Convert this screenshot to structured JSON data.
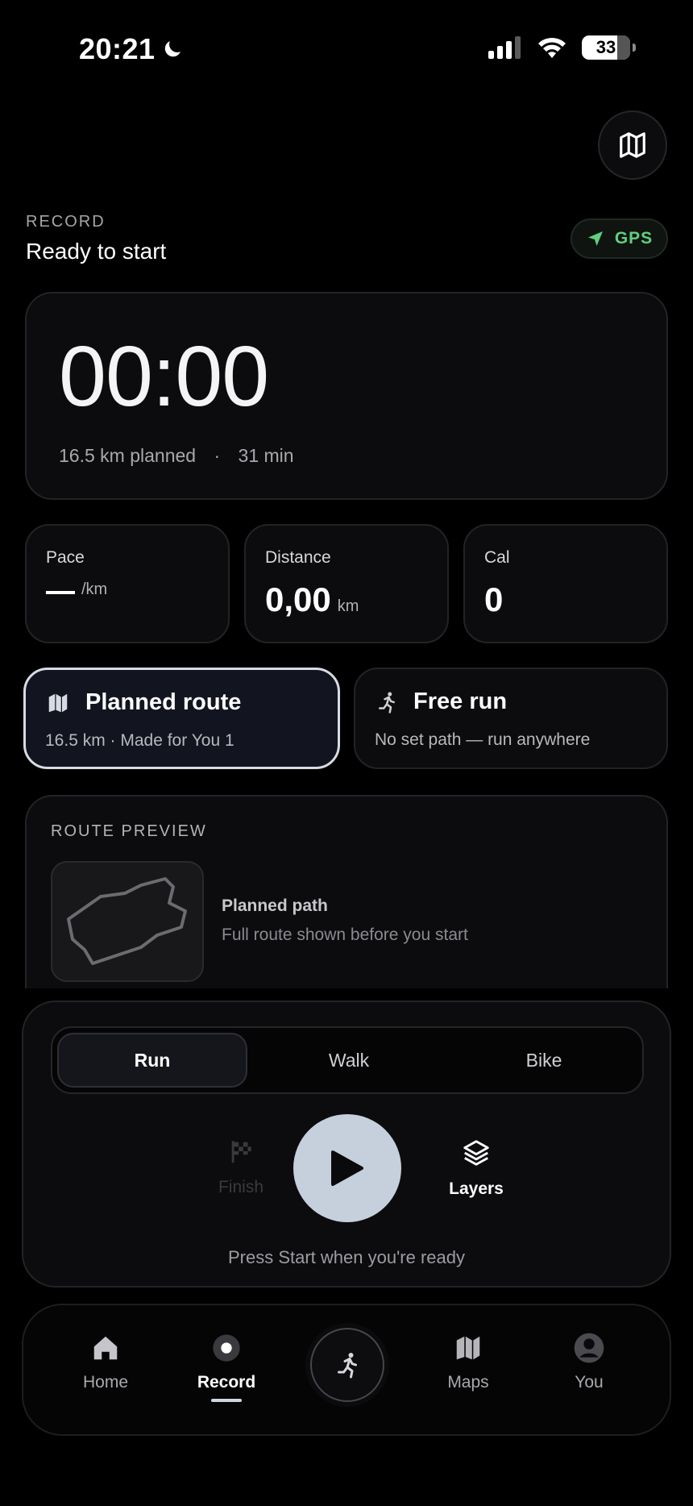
{
  "status_bar": {
    "time": "20:21",
    "battery": "33"
  },
  "header": {
    "section_label": "RECORD",
    "status": "Ready to start",
    "gps_label": "GPS"
  },
  "timer": {
    "value": "00:00",
    "planned_distance": "16.5 km planned",
    "separator": "·",
    "planned_time": "31 min"
  },
  "stats": [
    {
      "label": "Pace",
      "value": "",
      "unit": "/km"
    },
    {
      "label": "Distance",
      "value": "0,00",
      "unit": "km"
    },
    {
      "label": "Cal",
      "value": "0",
      "unit": ""
    }
  ],
  "route_options": [
    {
      "title": "Planned route",
      "subtitle": "16.5 km · Made for You 1",
      "icon": "map-icon",
      "selected": true
    },
    {
      "title": "Free run",
      "subtitle": "No set path — run anywhere",
      "icon": "runner-icon",
      "selected": false
    }
  ],
  "route_preview": {
    "label": "ROUTE PREVIEW",
    "title": "Planned path",
    "subtitle": "Full route shown before you start"
  },
  "activity_types": [
    {
      "label": "Run",
      "active": true
    },
    {
      "label": "Walk",
      "active": false
    },
    {
      "label": "Bike",
      "active": false
    }
  ],
  "controls": {
    "finish_label": "Finish",
    "layers_label": "Layers",
    "hint": "Press Start when you're ready"
  },
  "tabbar": {
    "items": [
      {
        "label": "Home",
        "icon": "home-icon",
        "active": false
      },
      {
        "label": "Record",
        "icon": "record-icon",
        "active": true
      },
      {
        "label": "Maps",
        "icon": "maps-icon",
        "active": false
      },
      {
        "label": "You",
        "icon": "profile-icon",
        "active": false
      }
    ]
  },
  "colors": {
    "accent": "#c6d0dc",
    "gps_green": "#5fd07e",
    "background": "#000000",
    "card": "#0c0c0e"
  }
}
